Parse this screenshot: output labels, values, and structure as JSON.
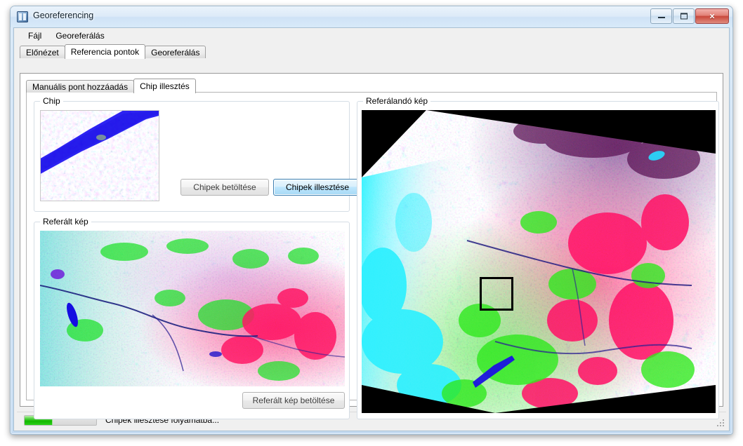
{
  "window": {
    "title": "Georeferencing",
    "icon": "app-icon",
    "controls": {
      "minimize": "minimize-icon",
      "maximize": "maximize-icon",
      "close": "×"
    }
  },
  "menu": {
    "items": [
      {
        "label": "Fájl"
      },
      {
        "label": "Georeferálás"
      }
    ]
  },
  "tabs": {
    "items": [
      {
        "label": "Előnézet",
        "active": false
      },
      {
        "label": "Referencia pontok",
        "active": true
      },
      {
        "label": "Georeferálás",
        "active": false
      }
    ]
  },
  "inner_tabs": {
    "items": [
      {
        "label": "Manuális pont hozzáadás",
        "active": false
      },
      {
        "label": "Chip illesztés",
        "active": true
      }
    ]
  },
  "groups": {
    "chip": {
      "legend": "Chip"
    },
    "referalt_kep": {
      "legend": "Referált kép"
    },
    "referalando_kep": {
      "legend": "Referálandó kép"
    }
  },
  "buttons": {
    "load_chips": {
      "label": "Chipek betöltése",
      "enabled": false,
      "focused": false
    },
    "match_chips": {
      "label": "Chipek illesztése",
      "enabled": true,
      "focused": true
    },
    "load_reference_image": {
      "label": "Referált kép betöltése",
      "enabled": true,
      "focused": false
    }
  },
  "statusbar": {
    "progress_percent": 38,
    "message": "Chipek illesztése folyamatba..."
  },
  "colors": {
    "accent": "#3c7fb1",
    "progress_green": "#14b800",
    "close_red": "#c9483b",
    "window_chrome": "#cfe2f5",
    "panel": "#ffffff"
  },
  "imagery": {
    "chip": {
      "description": "false-colour satellite chip with blue water band running lower-left to upper-right"
    },
    "reference": {
      "description": "false-colour reference scene: cyan west, magenta/red east, green patches, dark river lines"
    },
    "target": {
      "description": "rotated false-colour scene to be georeferenced with black no-data corners and bright cyan cloud area on west edge",
      "marker_label": "chip-location-box"
    }
  }
}
